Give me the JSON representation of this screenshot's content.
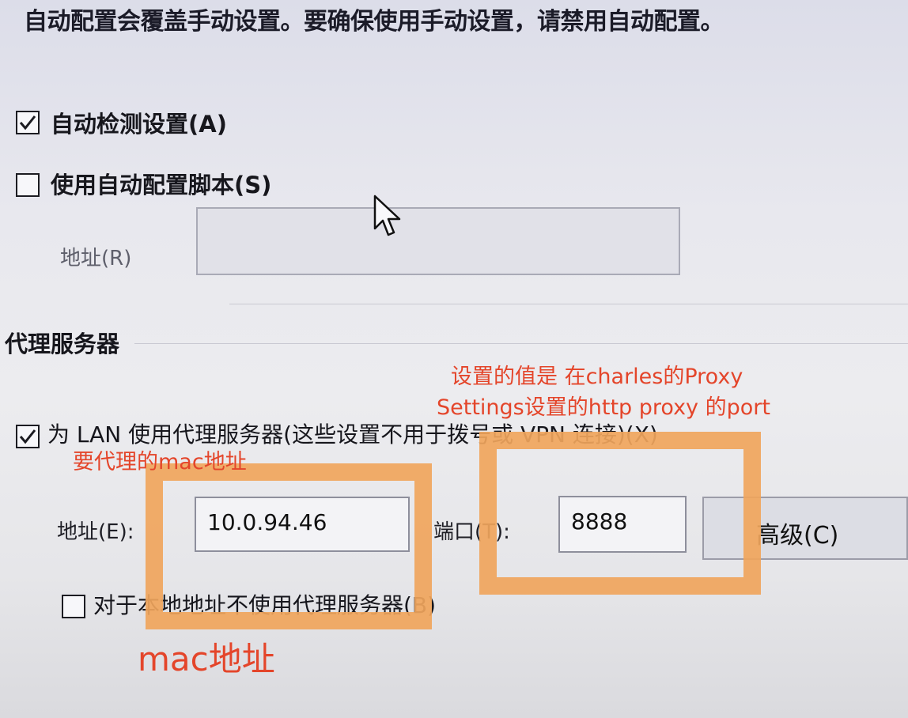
{
  "auto_config": {
    "notice": "自动配置会覆盖手动设置。要确保使用手动设置，请禁用自动配置。",
    "auto_detect": {
      "label": "自动检测设置(A)",
      "checked": true
    },
    "use_script": {
      "label": "使用自动配置脚本(S)",
      "checked": false
    },
    "address_label": "地址(R)",
    "address_value": ""
  },
  "proxy": {
    "section_title": "代理服务器",
    "use_lan_proxy": {
      "label": "为 LAN 使用代理服务器(这些设置不用于拨号或 VPN 连接)(X)",
      "checked": true
    },
    "address_label": "地址(E):",
    "address_value": "10.0.94.46",
    "port_label": "端口(T):",
    "port_value": "8888",
    "advanced_label": "高级(C)",
    "bypass_local": {
      "label": "对于本地地址不使用代理服务器(B)",
      "checked": false
    }
  },
  "annotations": {
    "port_note_line1": "设置的值是 在charles的Proxy",
    "port_note_line2": "Settings设置的http proxy 的port",
    "address_note_top": "要代理的mac地址",
    "address_note_bottom": "mac地址",
    "highlight_color": "#f0a55c",
    "text_color": "#e4452a"
  },
  "icons": {
    "checkmark": "checkmark-icon",
    "cursor": "mouse-pointer-icon"
  }
}
